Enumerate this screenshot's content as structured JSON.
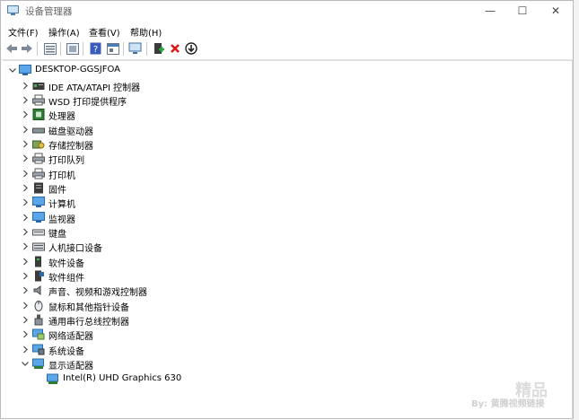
{
  "window": {
    "title": "设备管理器",
    "min": "—",
    "max": "☐",
    "close": "✕"
  },
  "menu": [
    "文件(F)",
    "操作(A)",
    "查看(V)",
    "帮助(H)"
  ],
  "tree": {
    "root": "DESKTOP-GGSJFOA",
    "items": [
      {
        "label": "IDE ATA/ATAPI 控制器",
        "icon": "ide-controller-icon"
      },
      {
        "label": "WSD 打印提供程序",
        "icon": "printer-icon"
      },
      {
        "label": "处理器",
        "icon": "processor-icon"
      },
      {
        "label": "磁盘驱动器",
        "icon": "disk-drive-icon"
      },
      {
        "label": "存储控制器",
        "icon": "storage-controller-icon"
      },
      {
        "label": "打印队列",
        "icon": "printer-icon"
      },
      {
        "label": "打印机",
        "icon": "printer-icon"
      },
      {
        "label": "固件",
        "icon": "firmware-icon"
      },
      {
        "label": "计算机",
        "icon": "computer-icon"
      },
      {
        "label": "监视器",
        "icon": "monitor-icon"
      },
      {
        "label": "键盘",
        "icon": "keyboard-icon"
      },
      {
        "label": "人机接口设备",
        "icon": "hid-icon"
      },
      {
        "label": "软件设备",
        "icon": "software-device-icon"
      },
      {
        "label": "软件组件",
        "icon": "software-component-icon"
      },
      {
        "label": "声音、视频和游戏控制器",
        "icon": "speaker-icon"
      },
      {
        "label": "鼠标和其他指针设备",
        "icon": "mouse-icon"
      },
      {
        "label": "通用串行总线控制器",
        "icon": "usb-icon"
      },
      {
        "label": "网络适配器",
        "icon": "network-adapter-icon"
      },
      {
        "label": "系统设备",
        "icon": "system-device-icon"
      },
      {
        "label": "显示适配器",
        "icon": "display-adapter-icon",
        "expanded": true
      }
    ],
    "child": "Intel(R) UHD Graphics 630"
  },
  "watermark": {
    "text": "By: 黄腾视频链接",
    "logo": "精品"
  }
}
